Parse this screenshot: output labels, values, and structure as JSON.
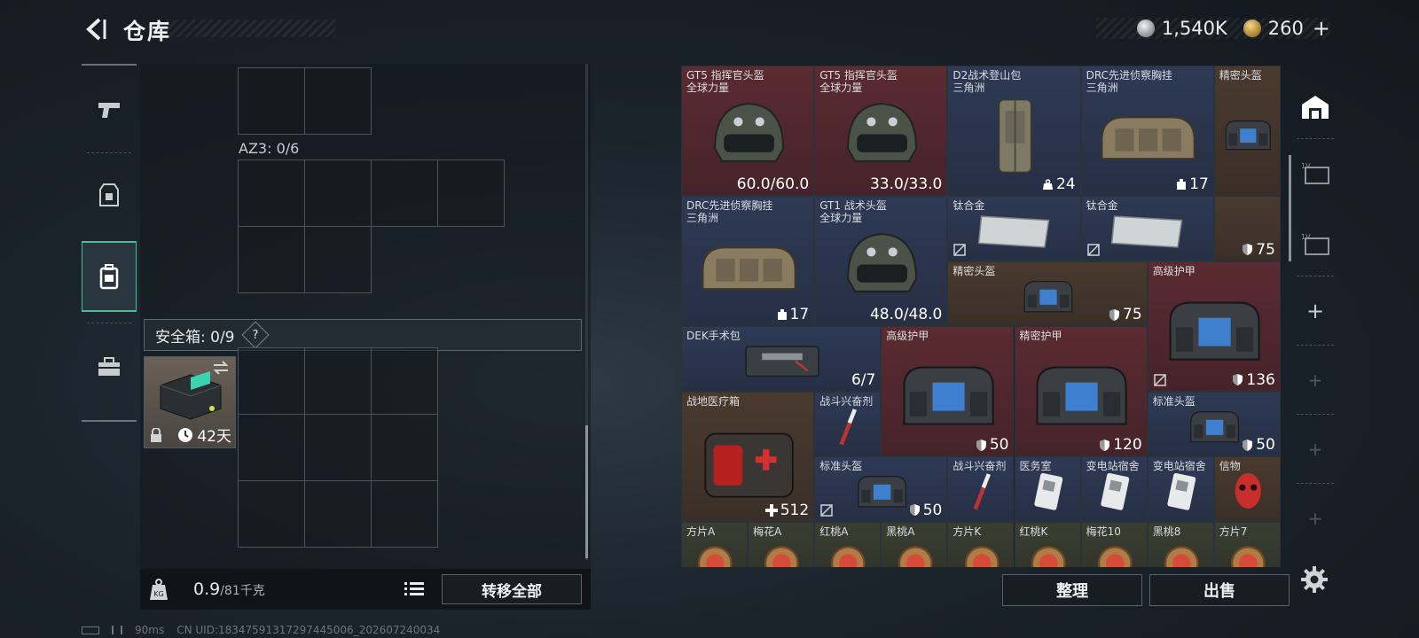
{
  "header": {
    "title": "仓库"
  },
  "currency": {
    "silver": "1,540K",
    "gold": "260",
    "add": "+"
  },
  "left_panel": {
    "az3_label": "AZ3: 0/6",
    "safe_box_label": "安全箱: 0/9",
    "safe_help": "?",
    "safe_days": "42天",
    "weight_value": "0.9",
    "weight_max": "/81千克",
    "transfer_all": "转移全部"
  },
  "inventory": {
    "items": [
      {
        "name": "GT5 指挥官头盔",
        "sub": "全球力量",
        "value": "60.0/60.0",
        "color": "red",
        "icon": "helmet-icon"
      },
      {
        "name": "GT5 指挥官头盔",
        "sub": "全球力量",
        "value": "33.0/33.0",
        "color": "red",
        "icon": "helmet-icon"
      },
      {
        "name": "D2战术登山包",
        "sub": "三角洲",
        "value": "24",
        "color": "blue",
        "icon": "backpack-icon"
      },
      {
        "name": "DRC先进侦察胸挂",
        "sub": "三角洲",
        "value": "17",
        "color": "blue",
        "icon": "chest-rig-icon"
      },
      {
        "name": "精密头盔",
        "sub": "",
        "value": "",
        "color": "brown",
        "icon": "armor-icon"
      },
      {
        "name": "DRC先进侦察胸挂",
        "sub": "三角洲",
        "value": "17",
        "color": "blue",
        "icon": "chest-rig-icon"
      },
      {
        "name": "GT1 战术头盔",
        "sub": "全球力量",
        "value": "48.0/48.0",
        "color": "blue",
        "icon": "helmet-icon"
      },
      {
        "name": "钛合金",
        "sub": "",
        "value": "",
        "color": "blue",
        "icon": "metal-plate-icon"
      },
      {
        "name": "钛合金",
        "sub": "",
        "value": "",
        "color": "blue",
        "icon": "metal-plate-icon"
      },
      {
        "name": "",
        "sub": "",
        "value": "75",
        "color": "brown",
        "icon": ""
      },
      {
        "name": "精密头盔",
        "sub": "",
        "value": "75",
        "color": "brown",
        "icon": "armor-icon"
      },
      {
        "name": "高级护甲",
        "sub": "",
        "value": "136",
        "color": "red",
        "icon": "armor-icon"
      },
      {
        "name": "DEK手术包",
        "sub": "",
        "value": "6/7",
        "color": "blue",
        "icon": "surgery-kit-icon"
      },
      {
        "name": "高级护甲",
        "sub": "",
        "value": "50",
        "color": "red",
        "icon": "armor-icon"
      },
      {
        "name": "精密护甲",
        "sub": "",
        "value": "120",
        "color": "red",
        "icon": "armor-icon"
      },
      {
        "name": "战地医疗箱",
        "sub": "",
        "value": "512",
        "color": "brown",
        "icon": "medkit-icon"
      },
      {
        "name": "战斗兴奋剂",
        "sub": "",
        "value": "",
        "color": "blue",
        "icon": "syringe-icon"
      },
      {
        "name": "标准头盔",
        "sub": "",
        "value": "50",
        "color": "blue",
        "icon": "armor-icon"
      },
      {
        "name": "标准头盔",
        "sub": "",
        "value": "50",
        "color": "blue",
        "icon": "armor-icon"
      },
      {
        "name": "战斗兴奋剂",
        "sub": "",
        "value": "",
        "color": "blue",
        "icon": "syringe-icon"
      },
      {
        "name": "医务室",
        "sub": "",
        "value": "",
        "color": "blue",
        "icon": "keycard-icon"
      },
      {
        "name": "变电站宿舍",
        "sub": "",
        "value": "",
        "color": "blue",
        "icon": "keycard-icon"
      },
      {
        "name": "变电站宿舍",
        "sub": "",
        "value": "",
        "color": "blue",
        "icon": "keycard-icon"
      },
      {
        "name": "信物",
        "sub": "",
        "value": "",
        "color": "brown",
        "icon": "mask-icon"
      },
      {
        "name": "方片A",
        "sub": "",
        "value": "",
        "color": "olive",
        "icon": "card-icon"
      },
      {
        "name": "梅花A",
        "sub": "",
        "value": "",
        "color": "olive",
        "icon": "card-icon"
      },
      {
        "name": "红桃A",
        "sub": "",
        "value": "",
        "color": "olive",
        "icon": "card-icon"
      },
      {
        "name": "黑桃A",
        "sub": "",
        "value": "",
        "color": "olive",
        "icon": "card-icon"
      },
      {
        "name": "方片K",
        "sub": "",
        "value": "",
        "color": "olive",
        "icon": "card-icon"
      },
      {
        "name": "红桃K",
        "sub": "",
        "value": "",
        "color": "olive",
        "icon": "card-icon"
      },
      {
        "name": "梅花10",
        "sub": "",
        "value": "",
        "color": "olive",
        "icon": "card-icon"
      },
      {
        "name": "黑桃8",
        "sub": "",
        "value": "",
        "color": "olive",
        "icon": "card-icon"
      },
      {
        "name": "方片7",
        "sub": "",
        "value": "",
        "color": "olive",
        "icon": "card-icon"
      }
    ]
  },
  "buttons": {
    "sort": "整理",
    "sell": "出售"
  },
  "status": {
    "ping": "90ms",
    "uid": "CN UID:18347591317297445006_202607240034"
  },
  "colors": {
    "accent": "#3fc29a",
    "red_rarity": "#5a2b31",
    "blue_rarity": "#2e3a55",
    "brown_rarity": "#4a3a2e"
  }
}
